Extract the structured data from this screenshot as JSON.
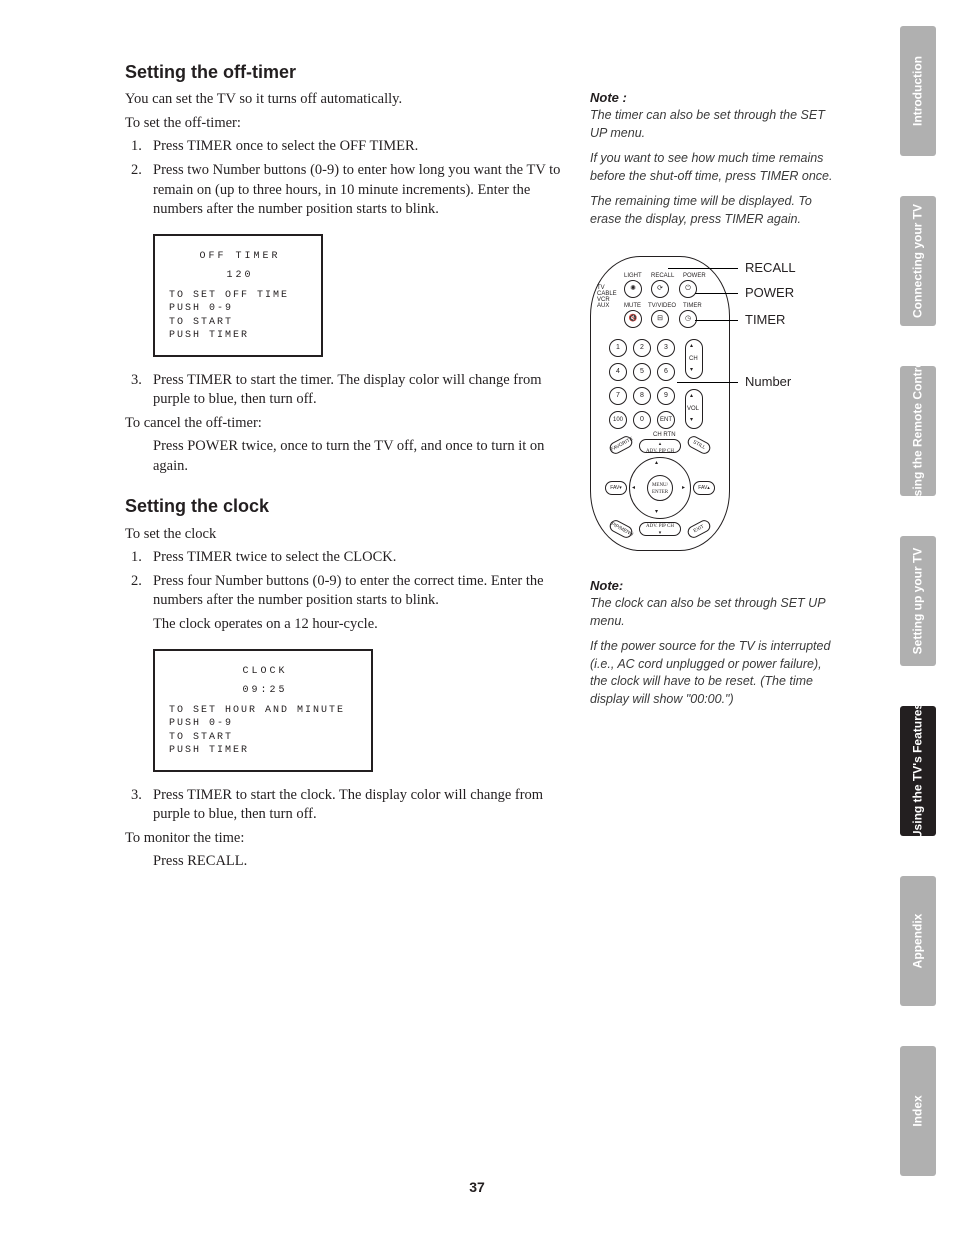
{
  "page_number": "37",
  "tabs": [
    {
      "label": "Introduction",
      "active": false
    },
    {
      "label": "Connecting your TV",
      "active": false
    },
    {
      "label": "Using the Remote Control",
      "active": false
    },
    {
      "label": "Setting up your TV",
      "active": false
    },
    {
      "label": "Using the TV's Features",
      "active": true
    },
    {
      "label": "Appendix",
      "active": false
    },
    {
      "label": "Index",
      "active": false
    }
  ],
  "section1": {
    "heading": "Setting the off-timer",
    "intro": "You can set the TV so it turns off automatically.",
    "to_set": "To set the off-timer:",
    "steps": [
      "Press TIMER once to select the OFF TIMER.",
      "Press two Number buttons (0-9) to enter how long you want the TV to remain on (up to three hours, in 10 minute increments). Enter the numbers after the number position starts to blink.",
      "Press TIMER to start the timer. The display color will change from purple to blue, then turn off."
    ],
    "screen": {
      "title": "OFF TIMER",
      "value": "120",
      "l1": "TO SET OFF TIME",
      "l2": " PUSH 0-9",
      "l3": "TO START",
      "l4": " PUSH TIMER"
    },
    "to_cancel": "To cancel the off-timer:",
    "cancel_body": "Press POWER twice, once to turn the TV off, and once to turn it on again."
  },
  "section2": {
    "heading": "Setting the clock",
    "to_set": "To set the clock",
    "steps_a": [
      "Press TIMER twice to select the CLOCK.",
      "Press four Number buttons (0-9) to enter the correct time. Enter the numbers after the number position starts to blink."
    ],
    "extra": "The clock operates on a 12 hour-cycle.",
    "screen": {
      "title": "CLOCK",
      "value": "09:25",
      "l1": "TO SET HOUR AND MINUTE",
      "l2": " PUSH 0-9",
      "l3": "TO START",
      "l4": " PUSH TIMER"
    },
    "step3": "Press TIMER to start the clock. The display color will change from purple to blue, then turn off.",
    "to_monitor": "To monitor the time:",
    "monitor_body": "Press RECALL."
  },
  "note1": {
    "heading": "Note :",
    "p1": "The timer can also be set through the SET UP menu.",
    "p2": "If you want to see how much time remains before the shut-off time, press TIMER once.",
    "p3": "The remaining time will be displayed. To erase the display, press TIMER again."
  },
  "note2": {
    "heading": "Note:",
    "p1": "The clock can also be set through SET UP menu.",
    "p2": "If the power source for the TV is interrupted (i.e., AC cord unplugged or power failure), the clock will have to be reset. (The time display will show \"00:00.\")"
  },
  "remote": {
    "callouts": {
      "recall": "RECALL",
      "power": "POWER",
      "timer": "TIMER",
      "number": "Number"
    },
    "top_row_labels": {
      "a": "LIGHT",
      "b": "RECALL",
      "c": "POWER"
    },
    "mid_row_labels": {
      "a": "MUTE",
      "b": "TV/VIDEO",
      "c": "TIMER"
    },
    "selector_labels": {
      "a": "TV",
      "b": "CABLE",
      "c": "VCR",
      "d": "AUX"
    },
    "ch_label": "CH",
    "vol_label": "VOL",
    "chrtn_label": "CH RTN",
    "num": {
      "1": "1",
      "2": "2",
      "3": "3",
      "4": "4",
      "5": "5",
      "6": "6",
      "7": "7",
      "8": "8",
      "9": "9",
      "0": "0",
      "100": "100",
      "ent": "ENT"
    },
    "pipch_top": "ADV. PIP CH",
    "pipch_bot": "ADV. PIP CH",
    "favorite": "FAVORITE",
    "still": "STILL",
    "menu": "MENU/ ENTER",
    "fav_l": "FAV▾",
    "fav_r": "FAV▴",
    "pipmenu": "PIP/MENU",
    "exit": "EXIT"
  }
}
